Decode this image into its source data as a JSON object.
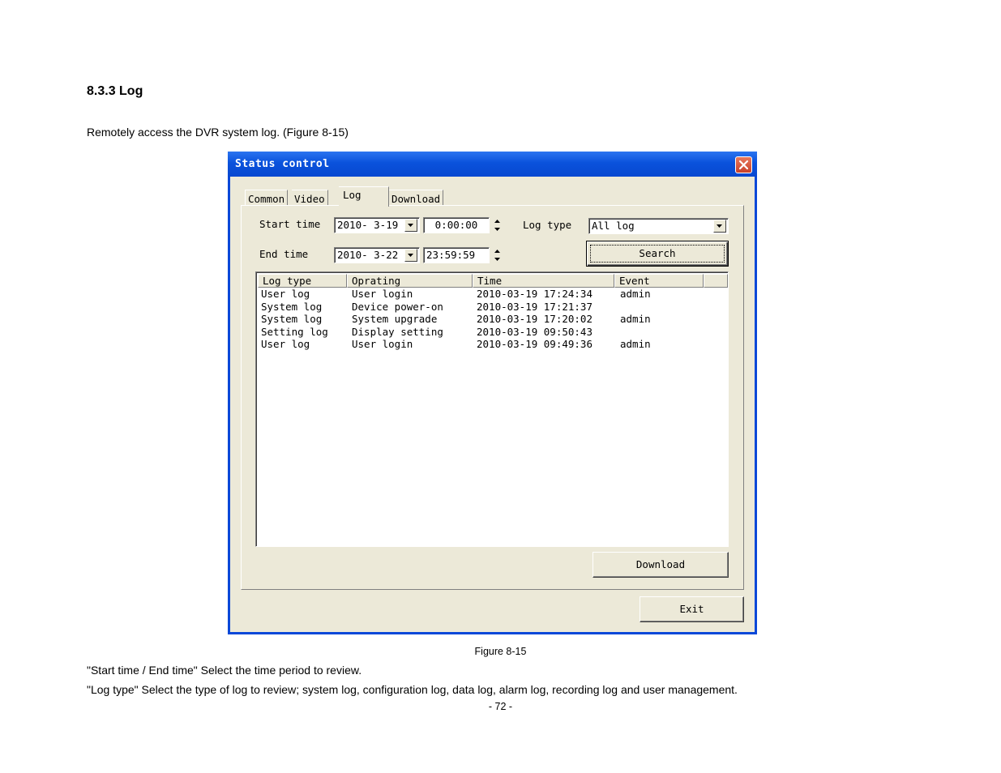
{
  "document": {
    "heading": "8.3.3 Log",
    "intro": "Remotely access the DVR system log. (Figure 8-15)",
    "caption": "Figure 8-15",
    "para1": "\"Start time / End time\" Select the time period to review.",
    "para2": "\"Log type\" Select the type of log to review; system log, configuration log, data log, alarm log, recording log and user management.",
    "page_number": "- 72 -"
  },
  "window": {
    "title": "Status control",
    "close_icon": "close-icon",
    "tabs": [
      {
        "label": "Common",
        "active": false
      },
      {
        "label": "Video",
        "active": false
      },
      {
        "label": "Log",
        "active": true
      },
      {
        "label": "Download",
        "active": false
      }
    ],
    "filters": {
      "start_label": "Start time",
      "start_date": "2010- 3-19",
      "start_time": "0:00:00",
      "end_label": "End time",
      "end_date": "2010- 3-22",
      "end_time": "23:59:59",
      "logtype_label": "Log type",
      "logtype_value": "All log",
      "search_label": "Search"
    },
    "table": {
      "headers": [
        "Log type",
        "Oprating",
        "Time",
        "Event"
      ],
      "rows": [
        [
          "User log",
          "User login",
          "2010-03-19 17:24:34",
          "admin"
        ],
        [
          "System log",
          "Device power-on",
          "2010-03-19 17:21:37",
          ""
        ],
        [
          "System log",
          "System upgrade",
          "2010-03-19 17:20:02",
          "admin"
        ],
        [
          "Setting log",
          "Display setting",
          "2010-03-19 09:50:43",
          ""
        ],
        [
          "User log",
          "User login",
          "2010-03-19 09:49:36",
          "admin"
        ]
      ]
    },
    "download_label": "Download",
    "exit_label": "Exit"
  }
}
